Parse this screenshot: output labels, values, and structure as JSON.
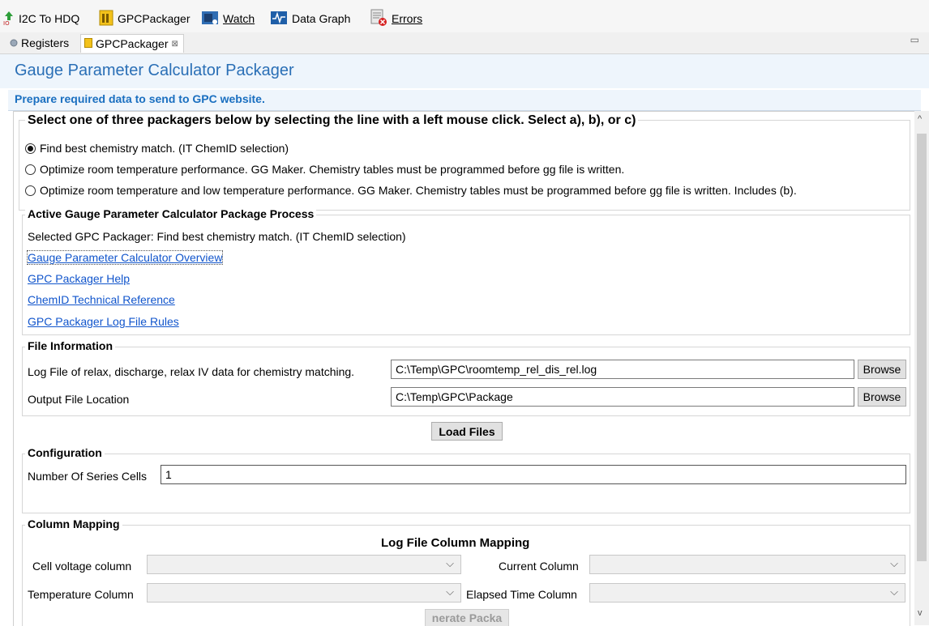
{
  "toolbar": {
    "items": [
      {
        "label": "I2C To HDQ",
        "icon": "i2c-hdq-icon"
      },
      {
        "label": "GPCPackager",
        "icon": "gpc-packager-icon"
      },
      {
        "label": "Watch",
        "icon": "watch-icon"
      },
      {
        "label": "Data Graph",
        "icon": "data-graph-icon"
      },
      {
        "label": "Errors",
        "icon": "errors-icon"
      }
    ]
  },
  "tabs": [
    {
      "label": "Registers",
      "icon": "registers-icon"
    },
    {
      "label": "GPCPackager",
      "icon": "gpc-packager-icon",
      "close": "⊠"
    }
  ],
  "page": {
    "title": "Gauge Parameter Calculator Packager",
    "subtitle": "Prepare required data to send to GPC website."
  },
  "packager_select": {
    "heading": "Select one of three packagers below by selecting the line with a left mouse click.  Select a), b), or c)",
    "options": [
      {
        "label": "Find best chemistry match. (IT ChemID selection)",
        "checked": true
      },
      {
        "label": "Optimize room temperature performance. GG Maker. Chemistry tables must be programmed before gg file is written.",
        "checked": false
      },
      {
        "label": "Optimize room temperature and low temperature performance. GG Maker. Chemistry tables must be programmed before gg file is written. Includes (b).",
        "checked": false
      }
    ]
  },
  "active_process": {
    "heading": "Active Gauge Parameter Calculator Package Process",
    "selected_text": "Selected GPC Packager:  Find best chemistry match. (IT ChemID selection)",
    "links": [
      "Gauge Parameter Calculator Overview",
      "GPC Packager Help",
      "ChemID Technical Reference",
      "GPC Packager Log File Rules"
    ]
  },
  "file_info": {
    "heading": "File Information",
    "log_label": "Log File of relax, discharge, relax IV data for chemistry matching.",
    "log_value": "C:\\Temp\\GPC\\roomtemp_rel_dis_rel.log",
    "output_label": "Output File Location",
    "output_value": "C:\\Temp\\GPC\\Package",
    "browse_label": "Browse",
    "load_label": "Load Files"
  },
  "configuration": {
    "heading": "Configuration",
    "series_label": "Number Of Series Cells",
    "series_value": "1"
  },
  "column_mapping": {
    "heading": "Column Mapping",
    "subheading": "Log File Column Mapping",
    "cell_voltage_label": "Cell voltage column",
    "current_label": "Current Column",
    "temperature_label": "Temperature Column",
    "elapsed_label": "Elapsed Time Column",
    "generate_label": "nerate Packa"
  }
}
